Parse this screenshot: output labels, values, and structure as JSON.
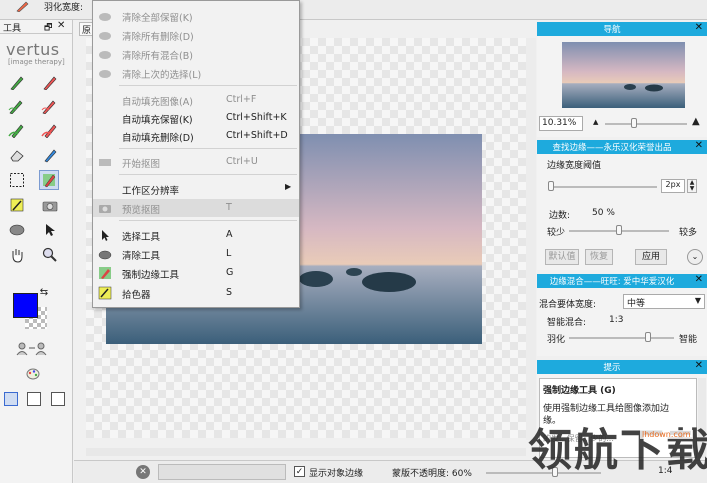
{
  "topbar": {
    "feather_label": "羽化宽度:"
  },
  "tools": {
    "title": "工具",
    "pin": "🗗",
    "close": "✕",
    "logo": "vertus",
    "logo_sub": "[image therapy]",
    "fg_color": "#0000ff"
  },
  "canvas": {
    "tab_label": "原"
  },
  "menu": {
    "items": [
      {
        "label": "清除全部保留(K)",
        "shortcut": "",
        "disabled": true
      },
      {
        "label": "清除所有删除(D)",
        "shortcut": "",
        "disabled": true
      },
      {
        "label": "清除所有混合(B)",
        "shortcut": "",
        "disabled": true
      },
      {
        "label": "清除上次的选择(L)",
        "shortcut": "",
        "disabled": true
      },
      {
        "label": "自动填充图像(A)",
        "shortcut": "Ctrl+F",
        "disabled": true
      },
      {
        "label": "自动填充保留(K)",
        "shortcut": "Ctrl+Shift+K",
        "disabled": false
      },
      {
        "label": "自动填充删除(D)",
        "shortcut": "Ctrl+Shift+D",
        "disabled": false
      },
      {
        "label": "开始抠图",
        "shortcut": "Ctrl+U",
        "disabled": true
      },
      {
        "label": "工作区分辨率",
        "shortcut": "",
        "disabled": false
      },
      {
        "label": "预览抠图",
        "shortcut": "T",
        "disabled": true
      },
      {
        "label": "选择工具",
        "shortcut": "A",
        "disabled": false
      },
      {
        "label": "清除工具",
        "shortcut": "L",
        "disabled": false
      },
      {
        "label": "强制边缘工具",
        "shortcut": "G",
        "disabled": false
      },
      {
        "label": "拾色器",
        "shortcut": "S",
        "disabled": false
      }
    ]
  },
  "nav": {
    "title": "导航",
    "zoom": "10.31%",
    "close": "✕",
    "zoom_position": 0.35
  },
  "edge": {
    "title": "查找边缘——永乐汉化荣誉出品",
    "close": "✕",
    "edge_width_label": "边缘宽度阈值",
    "edge_width_value": "2px",
    "edge_width_position": 0.02,
    "edge_label": "边数:",
    "edge_value": "50 %",
    "less": "较少",
    "more": "较多",
    "edge_position": 0.5,
    "default_btn": "默认值",
    "restore_btn": "恢复",
    "apply_btn": "应用"
  },
  "blend": {
    "title": "边缘混合——旺旺: 爱中华爱汉化",
    "close": "✕",
    "mode_label": "混合要体宽度:",
    "mode_value": "中等",
    "smart_label": "智能混合:",
    "smart_value": "1:3",
    "feather": "羽化",
    "smart": "智能",
    "feather_position": 0.75
  },
  "tips": {
    "title": "提示",
    "close": "✕",
    "heading": "强制边缘工具 (G)",
    "body": "使用强制边缘工具给图像添加边缘。",
    "extra": "的发...保留...少的..."
  },
  "status": {
    "show_edges_label": "显示对象边缘",
    "show_edges_checked": true,
    "opacity_label": "蒙版不透明度: 60%",
    "opacity_position": 0.6,
    "ratio": "1:4"
  },
  "watermark": {
    "text": "领航下载",
    "url": "lhdown.com"
  }
}
